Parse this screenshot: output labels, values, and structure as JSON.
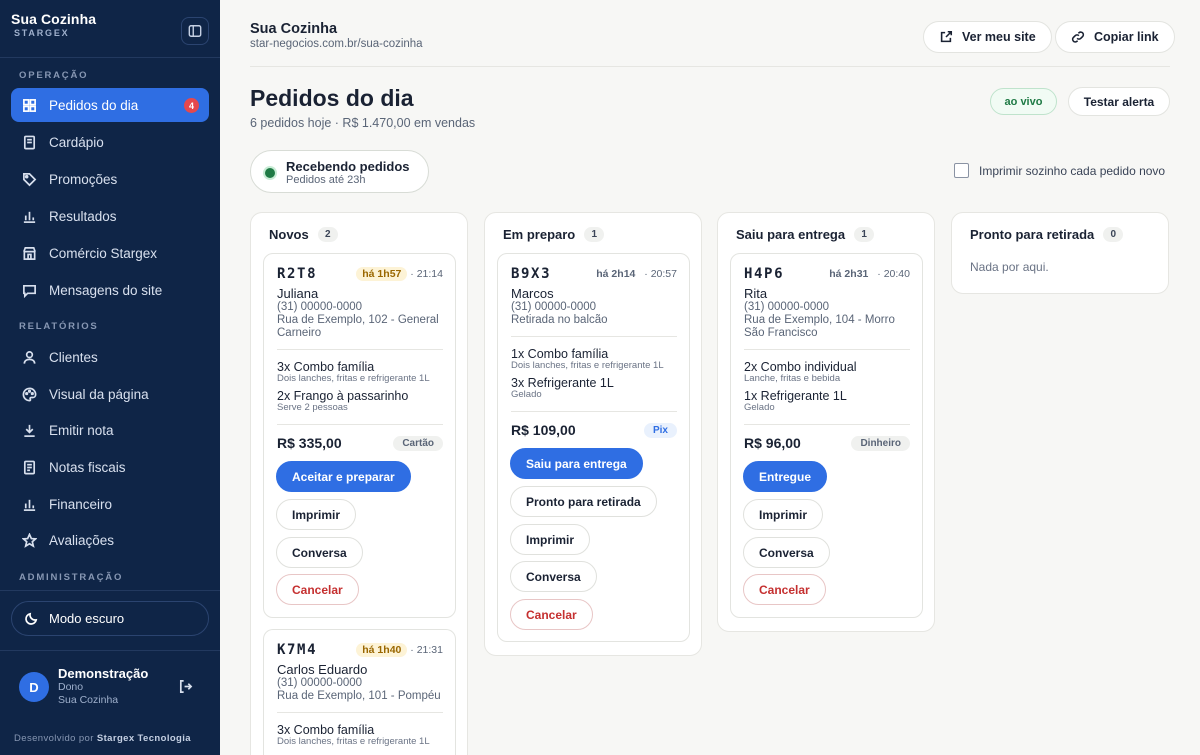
{
  "sidebar": {
    "brand": "Sua Cozinha",
    "brand_sub": "STARGEX",
    "section_operacao": "OPERAÇÃO",
    "section_relatorios": "RELATÓRIOS",
    "section_admin": "ADMINISTRAÇÃO",
    "items": [
      {
        "label": "Pedidos do dia",
        "icon": "grid-icon",
        "badge": "4",
        "active": true
      },
      {
        "label": "Cardápio",
        "icon": "menu-book-icon"
      },
      {
        "label": "Promoções",
        "icon": "tag-icon"
      },
      {
        "label": "Resultados",
        "icon": "bar-chart-icon"
      },
      {
        "label": "Comércio Stargex",
        "icon": "store-icon"
      },
      {
        "label": "Mensagens do site",
        "icon": "message-icon"
      },
      {
        "label": "Clientes",
        "icon": "person-icon"
      },
      {
        "label": "Visual da página",
        "icon": "palette-icon"
      },
      {
        "label": "Emitir nota",
        "icon": "download-icon"
      },
      {
        "label": "Notas fiscais",
        "icon": "receipt-icon"
      },
      {
        "label": "Financeiro",
        "icon": "bar-chart-icon"
      },
      {
        "label": "Avaliações",
        "icon": "star-icon"
      }
    ],
    "dark_mode": "Modo escuro",
    "user": {
      "initial": "D",
      "name": "Demonstração",
      "role": "Dono",
      "store": "Sua Cozinha"
    },
    "credit_prefix": "Desenvolvido por",
    "credit_name": "Stargex Tecnologia"
  },
  "header": {
    "title": "Sua Cozinha",
    "url": "star-negocios.com.br/sua-cozinha",
    "view_site": "Ver meu site",
    "copy_link": "Copiar link"
  },
  "page": {
    "title": "Pedidos do dia",
    "subtitle": "6 pedidos hoje · R$ 1.470,00 em vendas",
    "live": "ao vivo",
    "test_alert": "Testar alerta",
    "status_title": "Recebendo pedidos",
    "status_sub": "Pedidos até 23h",
    "auto_print": "Imprimir sozinho cada pedido novo"
  },
  "columns": {
    "novos": {
      "title": "Novos",
      "count": "2"
    },
    "preparo": {
      "title": "Em preparo",
      "count": "1"
    },
    "entrega": {
      "title": "Saiu para entrega",
      "count": "1"
    },
    "retirada": {
      "title": "Pronto para retirada",
      "count": "0",
      "empty": "Nada por aqui."
    }
  },
  "orders": {
    "r2t8": {
      "code": "R2T8",
      "age": "há 1h57",
      "time": "· 21:14",
      "customer": "Juliana",
      "phone": "(31) 00000-0000",
      "address": "Rua de Exemplo, 102 - General Carneiro",
      "items": [
        {
          "name": "3x Combo família",
          "desc": "Dois lanches, fritas e refrigerante 1L"
        },
        {
          "name": "2x Frango à passarinho",
          "desc": "Serve 2 pessoas"
        }
      ],
      "total": "R$ 335,00",
      "payment": "Cartão",
      "actions": [
        "Aceitar e preparar",
        "Imprimir",
        "Conversa",
        "Cancelar"
      ]
    },
    "k7m4": {
      "code": "K7M4",
      "age": "há 1h40",
      "time": "· 21:31",
      "customer": "Carlos Eduardo",
      "phone": "(31) 00000-0000",
      "address": "Rua de Exemplo, 101 - Pompéu",
      "items": [
        {
          "name": "3x Combo família",
          "desc": "Dois lanches, fritas e refrigerante 1L"
        }
      ]
    },
    "b9x3": {
      "code": "B9X3",
      "age": "há 2h14",
      "time": "· 20:57",
      "customer": "Marcos",
      "phone": "(31) 00000-0000",
      "address": "Retirada no balcão",
      "items": [
        {
          "name": "1x Combo família",
          "desc": "Dois lanches, fritas e refrigerante 1L"
        },
        {
          "name": "3x Refrigerante 1L",
          "desc": "Gelado"
        }
      ],
      "total": "R$ 109,00",
      "payment": "Pix",
      "actions": [
        "Saiu para entrega",
        "Pronto para retirada",
        "Imprimir",
        "Conversa",
        "Cancelar"
      ]
    },
    "h4p6": {
      "code": "H4P6",
      "age": "há 2h31",
      "time": "· 20:40",
      "customer": "Rita",
      "phone": "(31) 00000-0000",
      "address": "Rua de Exemplo, 104 - Morro São Francisco",
      "items": [
        {
          "name": "2x Combo individual",
          "desc": "Lanche, fritas e bebida"
        },
        {
          "name": "1x Refrigerante 1L",
          "desc": "Gelado"
        }
      ],
      "total": "R$ 96,00",
      "payment": "Dinheiro",
      "actions": [
        "Entregue",
        "Imprimir",
        "Conversa",
        "Cancelar"
      ]
    }
  },
  "colors": {
    "sidebar": "#0f2547",
    "accent": "#2f6ee3",
    "danger": "#c53030",
    "live": "#1f7a45"
  }
}
